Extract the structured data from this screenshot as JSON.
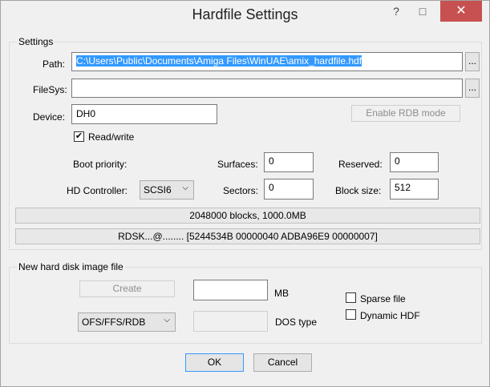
{
  "window": {
    "title": "Hardfile Settings",
    "help_icon": "?",
    "maximize_icon": "□",
    "close_icon": "✕"
  },
  "settings": {
    "group_label": "Settings",
    "path_label": "Path:",
    "path_value": "C:\\Users\\Public\\Documents\\Amiga Files\\WinUAE\\amix_hardfile.hdf",
    "filesys_label": "FileSys:",
    "filesys_value": "",
    "browse_label": "...",
    "device_label": "Device:",
    "device_value": "DH0",
    "enable_rdb_label": "Enable RDB mode",
    "readwrite_label": "Read/write",
    "readwrite_checked": true,
    "boot_priority_label": "Boot priority:",
    "surfaces_label": "Surfaces:",
    "surfaces_value": "0",
    "reserved_label": "Reserved:",
    "reserved_value": "0",
    "hd_controller_label": "HD Controller:",
    "hd_controller_value": "SCSI6",
    "sectors_label": "Sectors:",
    "sectors_value": "0",
    "block_size_label": "Block size:",
    "block_size_value": "512",
    "blocks_info": "2048000 blocks, 1000.0MB",
    "rdsk_info": "RDSK...@........ [5244534B 00000040 ADBA96E9 00000007]"
  },
  "new_image": {
    "group_label": "New hard disk image file",
    "create_label": "Create",
    "size_value": "",
    "mb_label": "MB",
    "sparse_label": "Sparse file",
    "dynamic_label": "Dynamic HDF",
    "fs_value": "OFS/FFS/RDB",
    "dos_type_value": "",
    "dos_type_label": "DOS type"
  },
  "footer": {
    "ok_label": "OK",
    "cancel_label": "Cancel"
  }
}
